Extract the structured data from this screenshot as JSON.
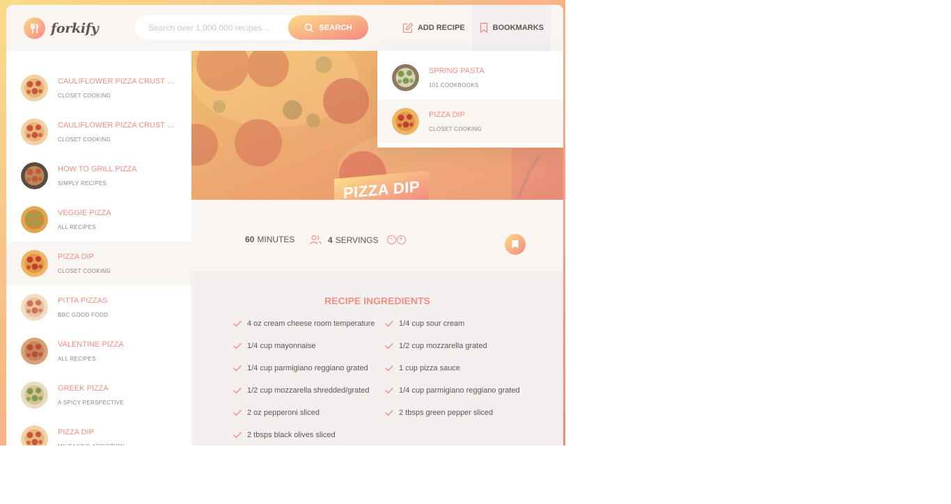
{
  "header": {
    "logo_text": "forkify",
    "search_placeholder": "Search over 1,000,000 recipes...",
    "search_button": "SEARCH",
    "add_recipe": "ADD RECIPE",
    "bookmarks": "BOOKMARKS"
  },
  "results": [
    {
      "title": "CAULIFLOWER PIZZA CRUST (WIT...",
      "publisher": "CLOSET COOKING",
      "thumb": "pizza"
    },
    {
      "title": "CAULIFLOWER PIZZA CRUST (WIT...",
      "publisher": "CLOSET COOKING",
      "thumb": "pizza"
    },
    {
      "title": "HOW TO GRILL PIZZA",
      "publisher": "SIMPLY RECIPES",
      "thumb": "grill"
    },
    {
      "title": "VEGGIE PIZZA",
      "publisher": "ALL RECIPES",
      "thumb": "veggie"
    },
    {
      "title": "PIZZA DIP",
      "publisher": "CLOSET COOKING",
      "thumb": "pepperoni"
    },
    {
      "title": "PITTA PIZZAS",
      "publisher": "BBC GOOD FOOD",
      "thumb": "pitta"
    },
    {
      "title": "VALENTINE PIZZA",
      "publisher": "ALL RECIPES",
      "thumb": "valentine"
    },
    {
      "title": "GREEK PIZZA",
      "publisher": "A SPICY PERSPECTIVE",
      "thumb": "greek"
    },
    {
      "title": "PIZZA DIP",
      "publisher": "MY BAKING ADDICTION",
      "thumb": "pizza"
    }
  ],
  "active_result_index": 4,
  "bookmarks": [
    {
      "title": "SPRING PASTA",
      "publisher": "101 COOKBOOKS",
      "thumb": "pasta"
    },
    {
      "title": "PIZZA DIP",
      "publisher": "CLOSET COOKING",
      "thumb": "pepperoni"
    }
  ],
  "recipe": {
    "title": "PIZZA DIP",
    "minutes": "60",
    "minutes_label": "MINUTES",
    "servings": "4",
    "servings_label": "SERVINGS",
    "ingredients_title": "RECIPE INGREDIENTS",
    "ingredients": [
      "4 oz cream cheese room temperature",
      "1/4 cup sour cream",
      "1/4 cup mayonnaise",
      "1/2 cup mozzarella grated",
      "1/4 cup parmigiano reggiano grated",
      "1 cup pizza sauce",
      "1/2 cup mozzarella shredded/grated",
      "1/4 cup parmigiano reggiano grated",
      "2 oz pepperoni sliced",
      "2 tbsps green pepper sliced",
      "2 tbsps black olives sliced"
    ]
  },
  "colors": {
    "accent_start": "#fbdb89",
    "accent_end": "#f48982",
    "accent_text": "#f38e82",
    "text": "#615551",
    "muted": "#918581",
    "light_bg": "#f9f5f3",
    "darker_bg": "#f2efee"
  }
}
